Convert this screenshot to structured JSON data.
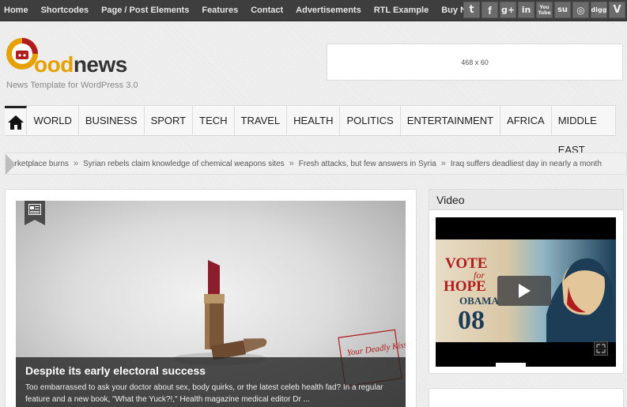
{
  "top_nav": [
    "Home",
    "Shortcodes",
    "Page / Post Elements",
    "Features",
    "Contact",
    "Advertisements",
    "RTL Example",
    "Buy Now"
  ],
  "social_icons": [
    "twitter-icon",
    "facebook-icon",
    "google-plus-icon",
    "linkedin-icon",
    "youtube-icon",
    "stumbleupon-icon",
    "dribbble-icon",
    "digg-icon",
    "vimeo-icon"
  ],
  "social_labels": {
    "twitter": "t",
    "facebook": "f",
    "google_plus": "g+",
    "linkedin": "in",
    "youtube": "You Tube",
    "stumbleupon": "su",
    "dribbble": "◎",
    "digg": "digg",
    "vimeo": "V"
  },
  "logo": {
    "part1": "G",
    "part2": "ood",
    "part3": "news",
    "tagline": "News Template for WordPress 3.0"
  },
  "ad": {
    "label": "468 x 60"
  },
  "main_nav": [
    "WORLD",
    "BUSINESS",
    "SPORT",
    "TECH",
    "TRAVEL",
    "HEALTH",
    "POLITICS",
    "ENTERTAINMENT",
    "AFRICA",
    "MIDDLE EAST"
  ],
  "ticker": [
    "arketplace burns",
    "Syrian rebels claim knowledge of chemical weapons sites",
    "Fresh attacks, but few answers in Syria",
    "Iraq suffers deadliest day in nearly a month"
  ],
  "ticker_sep": "»",
  "featured": {
    "title": "Despite its early electoral success",
    "excerpt": "Too embarrassed to ask your doctor about sex, body quirks, or the latest celeb health fad? In a regular feature and a new book, \"What the Yuck?!,\" Health magazine medical editor Dr ...",
    "handwriting": "Your Deadly Kisses"
  },
  "video": {
    "heading": "Video",
    "poster_line1": "VOTE",
    "poster_line2": "for",
    "poster_line3": "HOPE",
    "poster_line4": "OBAMA",
    "poster_line5": "08"
  },
  "colors": {
    "topbar": "#3e3e3e",
    "accent": "#e6a000",
    "logo_red": "#b01b1b"
  }
}
